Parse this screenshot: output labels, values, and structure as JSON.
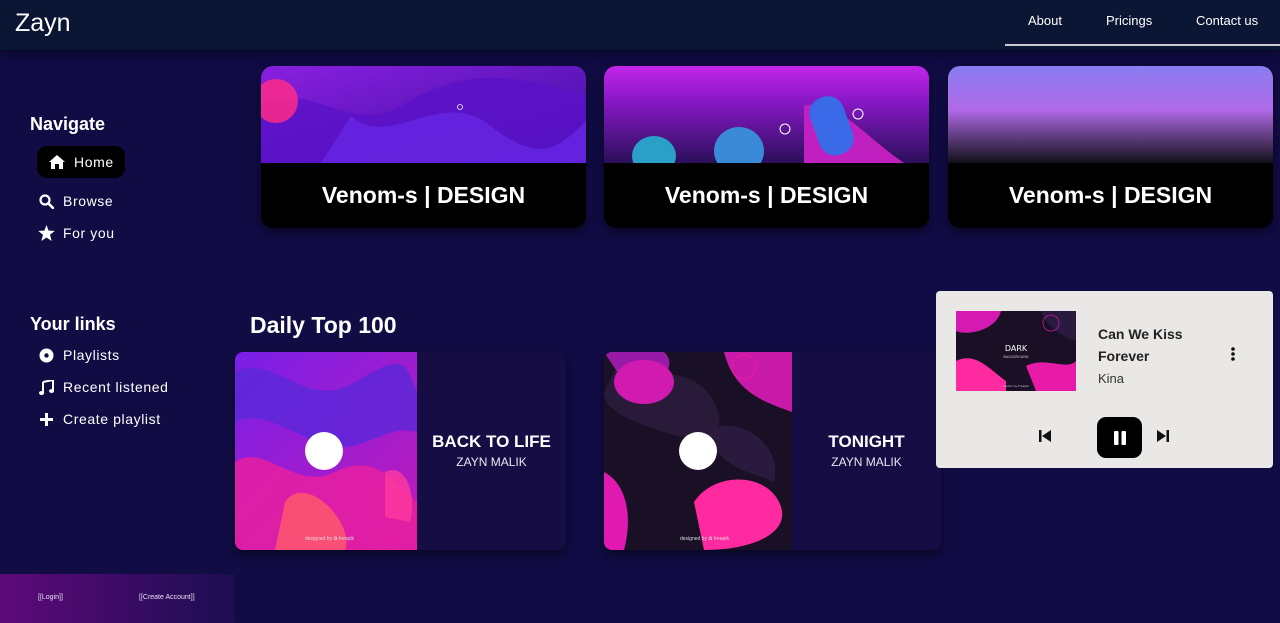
{
  "header": {
    "brand": "Zayn",
    "nav": [
      "About",
      "Pricings",
      "Contact us"
    ]
  },
  "sidebar": {
    "navigate_heading": "Navigate",
    "nav_items": [
      {
        "label": "Home",
        "icon": "home-icon",
        "active": true
      },
      {
        "label": "Browse",
        "icon": "search-icon",
        "active": false
      },
      {
        "label": "For you",
        "icon": "star-icon",
        "active": false
      }
    ],
    "links_heading": "Your links",
    "link_items": [
      {
        "label": "Playlists",
        "icon": "disc-icon"
      },
      {
        "label": "Recent listened",
        "icon": "music-note-icon"
      },
      {
        "label": "Create playlist",
        "icon": "plus-icon"
      }
    ],
    "auth": {
      "login": "[[Login]]",
      "create": "[[Create Account]]"
    }
  },
  "banners": [
    {
      "caption": "Venom-s | DESIGN"
    },
    {
      "caption": "Venom-s | DESIGN"
    },
    {
      "caption": "Venom-s | DESIGN"
    }
  ],
  "daily": {
    "title": "Daily Top 100",
    "songs": [
      {
        "title": "BACK TO LIFE",
        "artist": "ZAYN MALIK",
        "credit": "designed by ✿ freepik"
      },
      {
        "title": "TONIGHT",
        "artist": "ZAYN MALIK",
        "credit": "designed by ✿ freepik"
      }
    ]
  },
  "player": {
    "art_title": "DARK",
    "art_sub": "BACKGROUND",
    "art_credit": "Vector by Freepik",
    "title": "Can We Kiss Forever",
    "artist": "Kina"
  },
  "colors": {
    "background": "#110c44",
    "header": "#0b1534",
    "player": "#e9e8e6",
    "accent": "#e21c9c"
  }
}
